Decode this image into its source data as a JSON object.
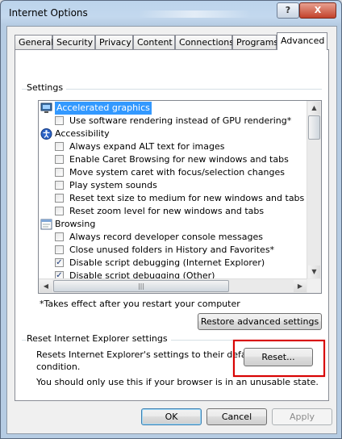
{
  "window": {
    "title": "Internet Options",
    "help_label": "?",
    "close_label": "X"
  },
  "tabs": [
    {
      "label": "General",
      "active": false
    },
    {
      "label": "Security",
      "active": false
    },
    {
      "label": "Privacy",
      "active": false
    },
    {
      "label": "Content",
      "active": false
    },
    {
      "label": "Connections",
      "active": false
    },
    {
      "label": "Programs",
      "active": false
    },
    {
      "label": "Advanced",
      "active": true
    }
  ],
  "settings": {
    "group_label": "Settings",
    "items": [
      {
        "type": "section",
        "icon": "monitor-icon",
        "label": "Accelerated graphics",
        "selected": true
      },
      {
        "type": "checkbox",
        "label": "Use software rendering instead of GPU rendering*",
        "checked": false
      },
      {
        "type": "section",
        "icon": "accessibility-icon",
        "label": "Accessibility"
      },
      {
        "type": "checkbox",
        "label": "Always expand ALT text for images",
        "checked": false
      },
      {
        "type": "checkbox",
        "label": "Enable Caret Browsing for new windows and tabs",
        "checked": false
      },
      {
        "type": "checkbox",
        "label": "Move system caret with focus/selection changes",
        "checked": false
      },
      {
        "type": "checkbox",
        "label": "Play system sounds",
        "checked": false
      },
      {
        "type": "checkbox",
        "label": "Reset text size to medium for new windows and tabs",
        "checked": false
      },
      {
        "type": "checkbox",
        "label": "Reset zoom level for new windows and tabs",
        "checked": false
      },
      {
        "type": "section",
        "icon": "browsing-icon",
        "label": "Browsing"
      },
      {
        "type": "checkbox",
        "label": "Always record developer console messages",
        "checked": false
      },
      {
        "type": "checkbox",
        "label": "Close unused folders in History and Favorites*",
        "checked": false
      },
      {
        "type": "checkbox",
        "label": "Disable script debugging (Internet Explorer)",
        "checked": true
      },
      {
        "type": "checkbox",
        "label": "Disable script debugging (Other)",
        "checked": true
      }
    ],
    "note": "*Takes effect after you restart your computer",
    "restore_label": "Restore advanced settings"
  },
  "reset": {
    "group_label": "Reset Internet Explorer settings",
    "description": "Resets Internet Explorer's settings to their default condition.",
    "description_line1": "Resets Internet Explorer's settings to their default",
    "description_line2": "condition.",
    "warning": "You should only use this if your browser is in an unusable state.",
    "button_label": "Reset...",
    "highlight_color": "#d80000"
  },
  "footer": {
    "ok_label": "OK",
    "cancel_label": "Cancel",
    "apply_label": "Apply"
  }
}
